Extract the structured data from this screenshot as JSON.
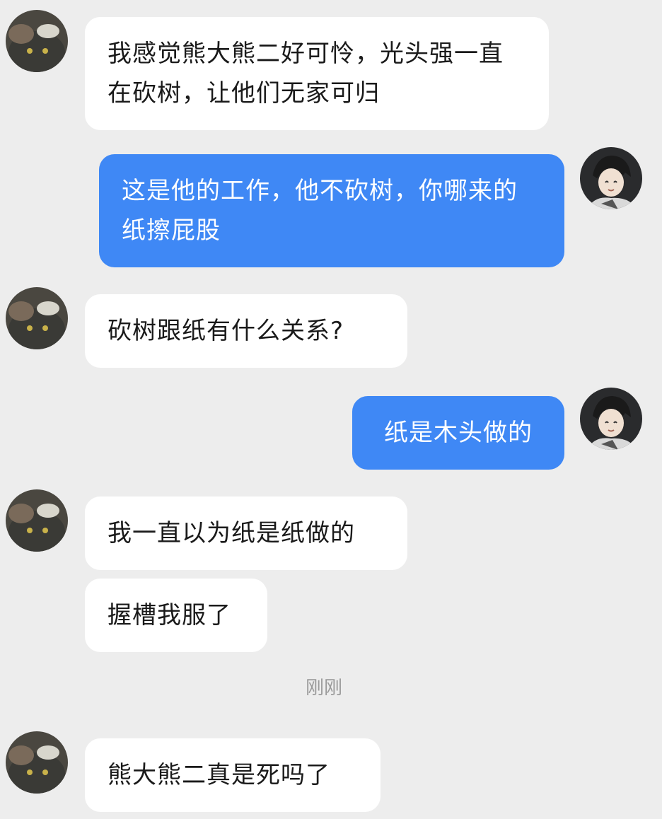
{
  "chat": {
    "messages": [
      {
        "side": "incoming",
        "avatar": "cat-avatar",
        "text": "我感觉熊大熊二好可怜，光头强一直在砍树，让他们无家可归"
      },
      {
        "side": "outgoing",
        "avatar": "anime-boy-avatar",
        "text": "这是他的工作，他不砍树，你哪来的纸擦屁股"
      },
      {
        "side": "incoming",
        "avatar": "cat-avatar",
        "text": "砍树跟纸有什么关系?"
      },
      {
        "side": "outgoing",
        "avatar": "anime-boy-avatar",
        "text": "纸是木头做的"
      },
      {
        "side": "incoming",
        "avatar": "cat-avatar",
        "text": "我一直以为纸是纸做的"
      },
      {
        "side": "incoming",
        "avatar": null,
        "text": "握槽我服了"
      },
      {
        "side": "incoming",
        "avatar": "cat-avatar",
        "text": "熊大熊二真是死吗了"
      }
    ],
    "timestamp": "刚刚"
  },
  "colors": {
    "background": "#ededed",
    "incoming_bubble": "#ffffff",
    "outgoing_bubble": "#3f88f5",
    "outgoing_text": "#ffffff",
    "timestamp_text": "#9a9a9a"
  }
}
